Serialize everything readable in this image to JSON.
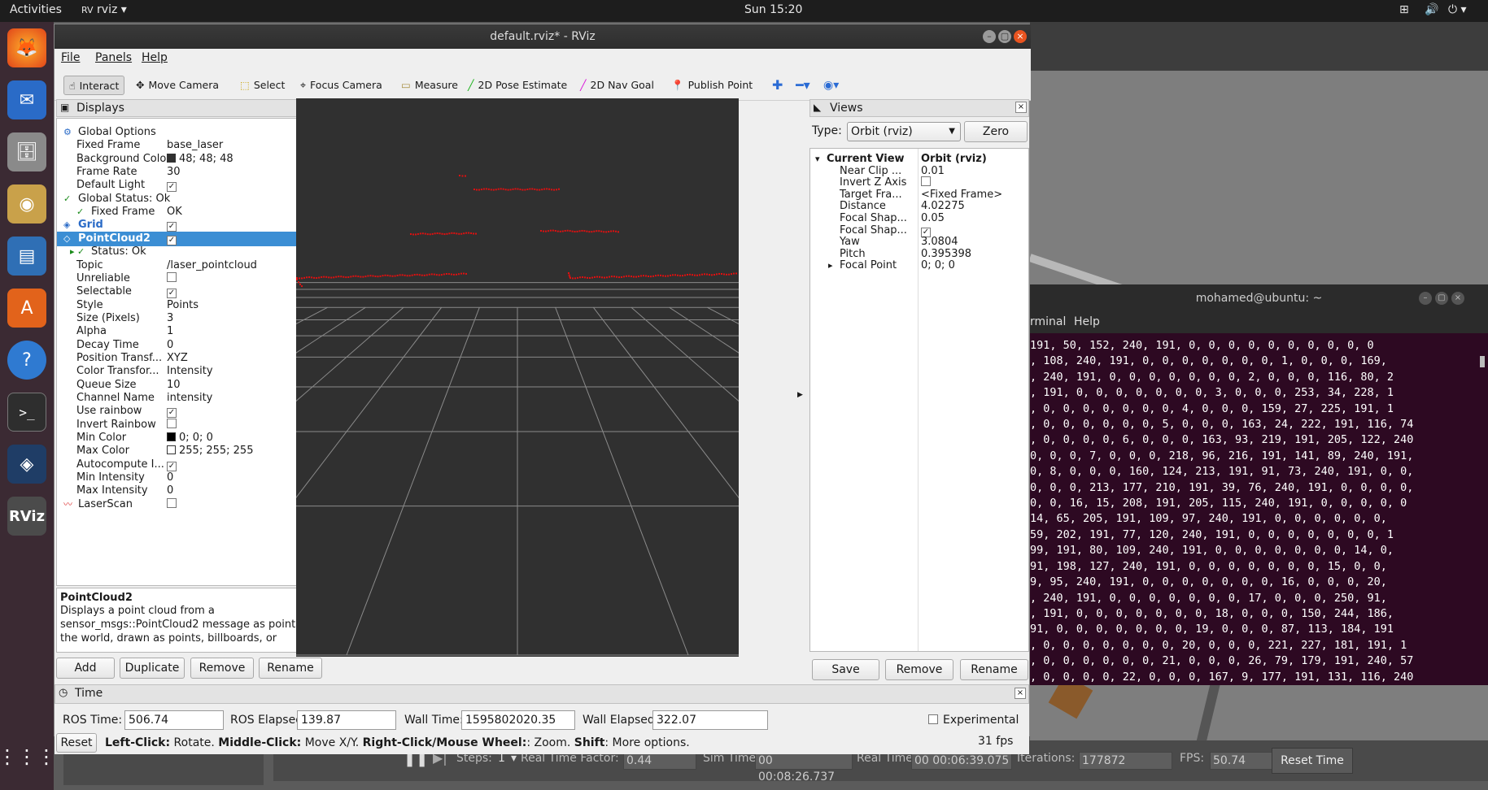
{
  "topbar": {
    "activities": "Activities",
    "app": "rviz",
    "clock": "Sun 15:20"
  },
  "colors": {
    "accent": "#3b8ed4",
    "viewport_bg": "#303030",
    "cloud": "#e01010",
    "terminal_bg": "#2d0922"
  },
  "dock": {
    "icons": [
      "firefox-icon",
      "thunderbird-icon",
      "files-icon",
      "rhythmbox-icon",
      "writer-icon",
      "software-icon",
      "help-icon",
      "terminal-icon",
      "virtualbox-icon",
      "rviz-icon",
      "app-grid-icon"
    ],
    "rviz_label": "RViz"
  },
  "window": {
    "title": "default.rviz* - RViz"
  },
  "menu": {
    "file": "File",
    "panels": "Panels",
    "help": "Help"
  },
  "toolbar": {
    "interact": "Interact",
    "move_camera": "Move Camera",
    "select": "Select",
    "focus_camera": "Focus Camera",
    "measure": "Measure",
    "pose_estimate": "2D Pose Estimate",
    "nav_goal": "2D Nav Goal",
    "publish_point": "Publish Point"
  },
  "displays": {
    "title": "Displays",
    "rows": [
      {
        "key": "Global Options",
        "value": ""
      },
      {
        "key": "Fixed Frame",
        "value": "base_laser"
      },
      {
        "key": "Background Color",
        "value": "48; 48; 48"
      },
      {
        "key": "Frame Rate",
        "value": "30"
      },
      {
        "key": "Default Light",
        "value": ""
      },
      {
        "key": "Global Status: Ok",
        "value": ""
      },
      {
        "key": "Fixed Frame",
        "value": "OK"
      },
      {
        "key": "Grid",
        "value": ""
      },
      {
        "key": "PointCloud2",
        "value": ""
      },
      {
        "key": "Status: Ok",
        "value": ""
      },
      {
        "key": "Topic",
        "value": "/laser_pointcloud"
      },
      {
        "key": "Unreliable",
        "value": ""
      },
      {
        "key": "Selectable",
        "value": ""
      },
      {
        "key": "Style",
        "value": "Points"
      },
      {
        "key": "Size (Pixels)",
        "value": "3"
      },
      {
        "key": "Alpha",
        "value": "1"
      },
      {
        "key": "Decay Time",
        "value": "0"
      },
      {
        "key": "Position Transf...",
        "value": "XYZ"
      },
      {
        "key": "Color Transfor...",
        "value": "Intensity"
      },
      {
        "key": "Queue Size",
        "value": "10"
      },
      {
        "key": "Channel Name",
        "value": "intensity"
      },
      {
        "key": "Use rainbow",
        "value": ""
      },
      {
        "key": "Invert Rainbow",
        "value": ""
      },
      {
        "key": "Min Color",
        "value": "0; 0; 0"
      },
      {
        "key": "Max Color",
        "value": "255; 255; 255"
      },
      {
        "key": "Autocompute I...",
        "value": ""
      },
      {
        "key": "Min Intensity",
        "value": "0"
      },
      {
        "key": "Max Intensity",
        "value": "0"
      },
      {
        "key": "LaserScan",
        "value": ""
      }
    ],
    "desc_title": "PointCloud2",
    "desc_text": "Displays a point cloud from a sensor_msgs::PointCloud2 message as points in the world, drawn as points, billboards, or",
    "add": "Add",
    "duplicate": "Duplicate",
    "remove": "Remove",
    "rename": "Rename"
  },
  "views": {
    "title": "Views",
    "type_label": "Type:",
    "type_value": "Orbit (rviz)",
    "zero": "Zero",
    "rows": [
      {
        "key": "Current View",
        "value": "Orbit (rviz)"
      },
      {
        "key": "Near Clip ...",
        "value": "0.01"
      },
      {
        "key": "Invert Z Axis",
        "value": ""
      },
      {
        "key": "Target Fra...",
        "value": "<Fixed Frame>"
      },
      {
        "key": "Distance",
        "value": "4.02275"
      },
      {
        "key": "Focal Shap...",
        "value": "0.05"
      },
      {
        "key": "Focal Shap...",
        "value": ""
      },
      {
        "key": "Yaw",
        "value": "3.0804"
      },
      {
        "key": "Pitch",
        "value": "0.395398"
      },
      {
        "key": "Focal Point",
        "value": "0; 0; 0"
      }
    ],
    "save": "Save",
    "remove": "Remove",
    "rename": "Rename"
  },
  "time": {
    "title": "Time",
    "ros_time_label": "ROS Time:",
    "ros_time": "506.74",
    "ros_elapsed_label": "ROS Elapsed:",
    "ros_elapsed": "139.87",
    "wall_time_label": "Wall Time:",
    "wall_time": "1595802020.35",
    "wall_elapsed_label": "Wall Elapsed:",
    "wall_elapsed": "322.07",
    "experimental": "Experimental"
  },
  "status": {
    "reset": "Reset",
    "lc": "Left-Click:",
    "lc_t": " Rotate. ",
    "mc": "Middle-Click:",
    "mc_t": " Move X/Y. ",
    "rc": "Right-Click/Mouse Wheel:",
    "rc_t": ": Zoom. ",
    "sh": "Shift",
    "sh_t": ": More options.",
    "fps": "31 fps"
  },
  "terminal": {
    "title": "mohamed@ubuntu: ~",
    "menu_terminal": "rminal",
    "menu_help": "Help",
    "lines": [
      "191, 50, 152, 240, 191, 0, 0, 0, 0, 0, 0, 0, 0, 0, 0",
      ", 108, 240, 191, 0, 0, 0, 0, 0, 0, 0, 1, 0, 0, 0, 169,",
      ", 240, 191, 0, 0, 0, 0, 0, 0, 0, 2, 0, 0, 0, 116, 80, 2",
      ", 191, 0, 0, 0, 0, 0, 0, 0, 3, 0, 0, 0, 253, 34, 228, 1",
      ", 0, 0, 0, 0, 0, 0, 0, 4, 0, 0, 0, 159, 27, 225, 191, 1",
      ", 0, 0, 0, 0, 0, 0, 5, 0, 0, 0, 163, 24, 222, 191, 116, 74",
      ", 0, 0, 0, 0, 6, 0, 0, 0, 163, 93, 219, 191, 205, 122, 240",
      "0, 0, 0, 7, 0, 0, 0, 218, 96, 216, 191, 141, 89, 240, 191,",
      "0, 8, 0, 0, 0, 160, 124, 213, 191, 91, 73, 240, 191, 0, 0,",
      "0, 0, 0, 213, 177, 210, 191, 39, 76, 240, 191, 0, 0, 0, 0,",
      "0, 0, 16, 15, 208, 191, 205, 115, 240, 191, 0, 0, 0, 0, 0",
      "14, 65, 205, 191, 109, 97, 240, 191, 0, 0, 0, 0, 0, 0,",
      "59, 202, 191, 77, 120, 240, 191, 0, 0, 0, 0, 0, 0, 0, 1",
      "99, 191, 80, 109, 240, 191, 0, 0, 0, 0, 0, 0, 0, 14, 0,",
      "91, 198, 127, 240, 191, 0, 0, 0, 0, 0, 0, 0, 15, 0, 0,",
      "9, 95, 240, 191, 0, 0, 0, 0, 0, 0, 0, 16, 0, 0, 0, 20,",
      ", 240, 191, 0, 0, 0, 0, 0, 0, 0, 17, 0, 0, 0, 250, 91,",
      ", 191, 0, 0, 0, 0, 0, 0, 0, 18, 0, 0, 0, 150, 244, 186,",
      "91, 0, 0, 0, 0, 0, 0, 0, 19, 0, 0, 0, 87, 113, 184, 191",
      ", 0, 0, 0, 0, 0, 0, 0, 20, 0, 0, 0, 221, 227, 181, 191, 1",
      ", 0, 0, 0, 0, 0, 0, 21, 0, 0, 0, 26, 79, 179, 191, 240, 57",
      ", 0, 0, 0, 0, 22, 0, 0, 0, 167, 9, 177, 191, 131, 116, 240"
    ]
  },
  "gazebo": {
    "steps_label": "Steps:",
    "steps": "1",
    "rtf_label": "Real Time Factor:",
    "rtf": "0.44",
    "sim_label": "Sim Time:",
    "sim": "00 00:08:26.737",
    "real_label": "Real Time:",
    "real": "00 00:06:39.075",
    "iter_label": "Iterations:",
    "iter": "177872",
    "fps_label": "FPS:",
    "fps": "50.74",
    "reset_time": "Reset Time"
  }
}
